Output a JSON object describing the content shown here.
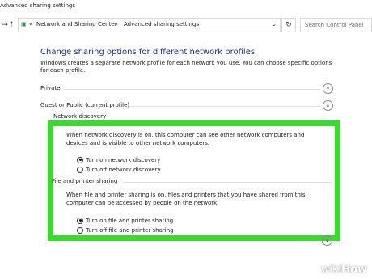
{
  "window": {
    "title": "Advanced sharing settings"
  },
  "address": {
    "back_icon": "arrow-back-icon",
    "forward_icon": "arrow-forward-icon",
    "up_icon": "arrow-up-icon",
    "breadcrumb_sep": "«",
    "crumbs": [
      "Network and Sharing Center",
      "Advanced sharing settings"
    ],
    "refresh_icon": "refresh-icon",
    "search_placeholder": "Search Control Panel"
  },
  "main": {
    "heading": "Change sharing options for different network profiles",
    "description": "Windows creates a separate network profile for each network you use. You can choose specific options for each profile.",
    "sections": [
      {
        "label": "Private",
        "state": "collapsed"
      },
      {
        "label": "Guest or Public (current profile)",
        "state": "expanded"
      }
    ],
    "network_discovery": {
      "label": "Network discovery",
      "description": "When network discovery is on, this computer can see other network computers and devices and is visible to other network computers.",
      "options": [
        "Turn on network discovery",
        "Turn off network discovery"
      ],
      "selected": 0
    },
    "file_sharing": {
      "label": "File and printer sharing",
      "description": "When file and printer sharing is on, files and printers that you have shared from this computer can be accessed by people on the network.",
      "options": [
        "Turn on file and printer sharing",
        "Turn off file and printer sharing"
      ],
      "selected": 0
    },
    "highlight_color": "#34de29"
  },
  "watermark": {
    "part1": "wiki",
    "part2": "How"
  }
}
